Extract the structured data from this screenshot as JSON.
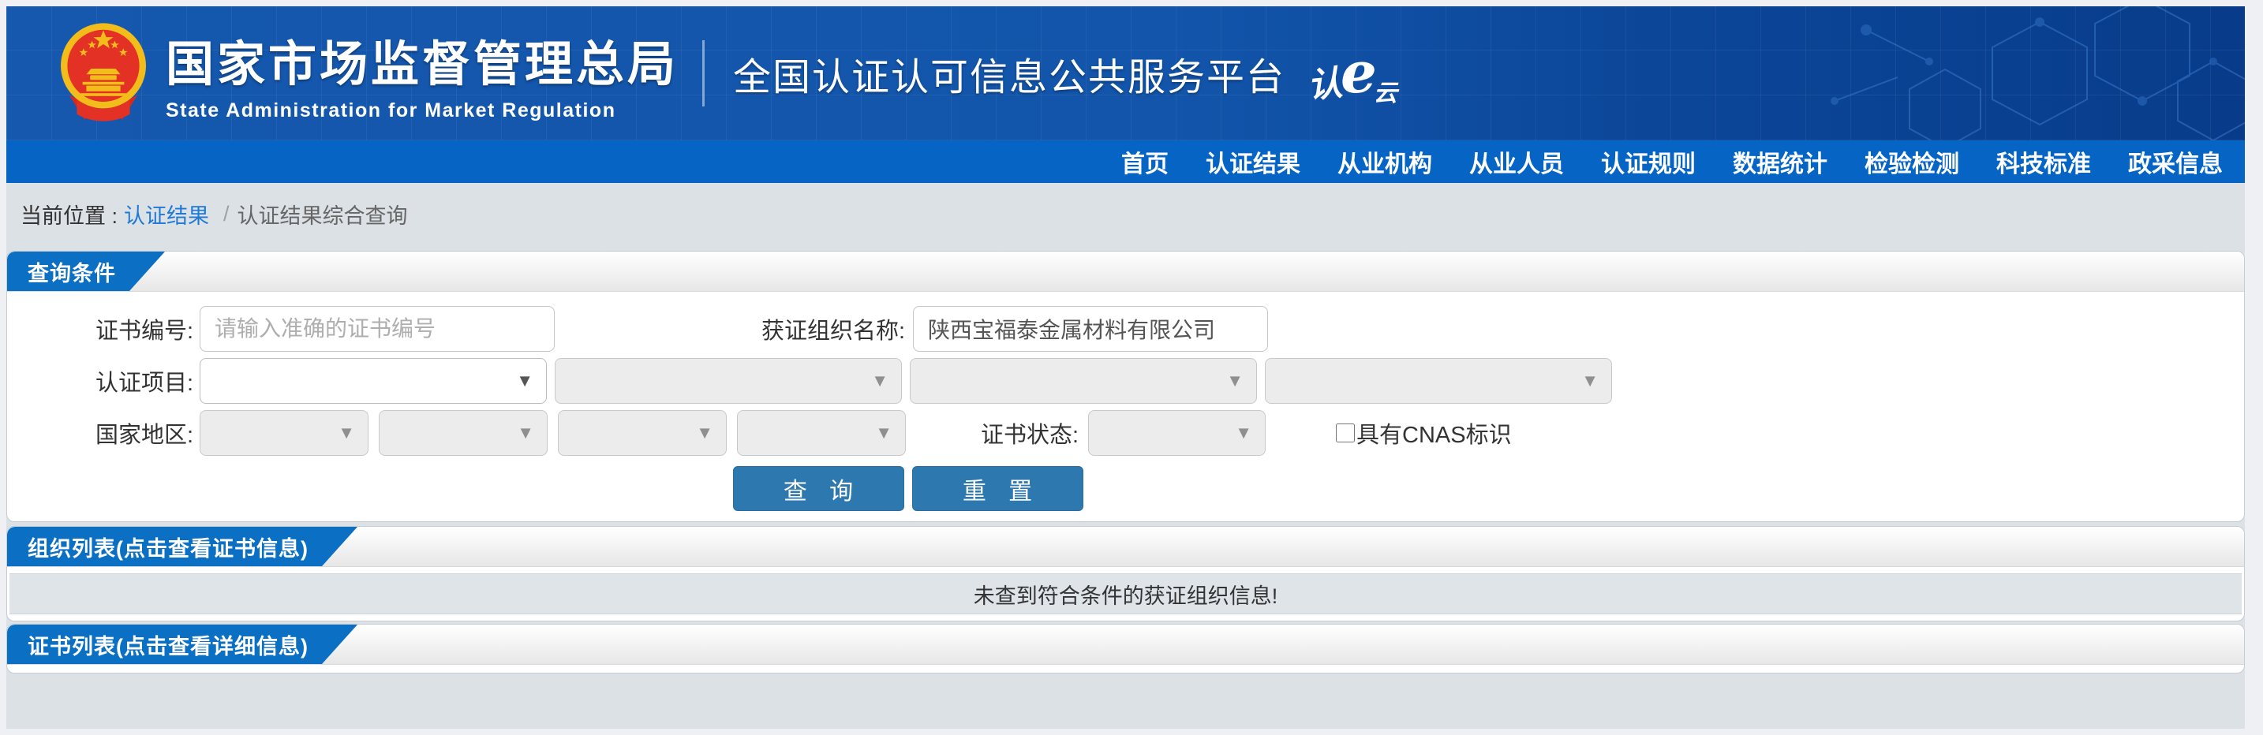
{
  "colors": {
    "header_blue": "#1457ac",
    "header_blue_dark": "#083c8a",
    "nav_blue": "#0564c4",
    "tab_blue": "#0b6fc3",
    "button_blue": "#2e78b0",
    "link_blue": "#1e7ad4",
    "page_gray": "#dce1e6",
    "emblem_red": "#e33125",
    "emblem_gold": "#f2bc1b"
  },
  "header": {
    "emblem_icon": "china-national-emblem",
    "org_name_cn": "国家市场监督管理总局",
    "org_name_en": "State Administration for Market Regulation",
    "platform_title": "全国认证认可信息公共服务平台",
    "logo": {
      "ren": "认",
      "e": "e",
      "yun": "云"
    }
  },
  "nav": {
    "items": [
      {
        "label": "首页"
      },
      {
        "label": "认证结果"
      },
      {
        "label": "从业机构"
      },
      {
        "label": "从业人员"
      },
      {
        "label": "认证规则"
      },
      {
        "label": "数据统计"
      },
      {
        "label": "检验检测"
      },
      {
        "label": "科技标准"
      },
      {
        "label": "政采信息"
      }
    ]
  },
  "breadcrumb": {
    "prefix": "当前位置 :",
    "link": "认证结果",
    "separator": "/",
    "current": "认证结果综合查询"
  },
  "query_panel": {
    "tab_label": "查询条件",
    "cert_no": {
      "label": "证书编号:",
      "placeholder": "请输入准确的证书编号",
      "value": ""
    },
    "org_name": {
      "label": "获证组织名称:",
      "value": "陕西宝福泰金属材料有限公司"
    },
    "cert_project": {
      "label": "认证项目:",
      "selects": [
        {
          "value": "",
          "enabled": true
        },
        {
          "value": "",
          "enabled": false
        },
        {
          "value": "",
          "enabled": false
        },
        {
          "value": "",
          "enabled": false
        }
      ]
    },
    "country": {
      "label": "国家地区:",
      "selects": [
        {
          "value": "",
          "enabled": false
        },
        {
          "value": "",
          "enabled": false
        },
        {
          "value": "",
          "enabled": false
        },
        {
          "value": "",
          "enabled": false
        }
      ]
    },
    "cert_status": {
      "label": "证书状态:",
      "value": "",
      "enabled": false
    },
    "cnas": {
      "label": "具有CNAS标识",
      "checked": false
    },
    "buttons": {
      "query": "查 询",
      "reset": "重 置"
    }
  },
  "org_panel": {
    "tab_label": "组织列表(点击查看证书信息)",
    "empty_message": "未查到符合条件的获证组织信息!"
  },
  "cert_panel": {
    "tab_label": "证书列表(点击查看详细信息)"
  }
}
